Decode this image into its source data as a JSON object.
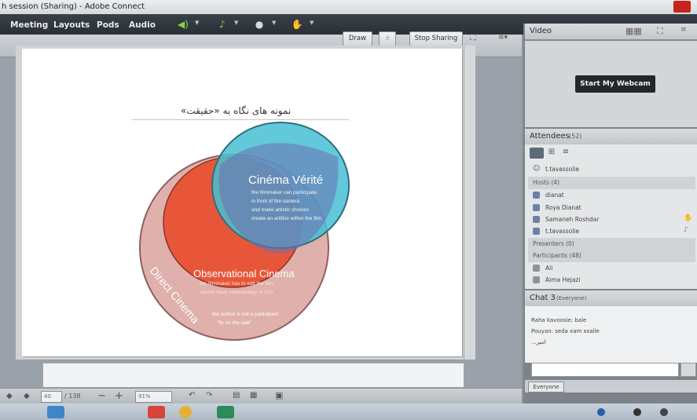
{
  "window": {
    "title": "h session (Sharing) - Adobe Connect"
  },
  "menubar": {
    "items": [
      "Meeting",
      "Layouts",
      "Pods",
      "Audio"
    ],
    "icons": [
      "speaker-icon",
      "microphone-icon",
      "person-icon",
      "raise-hand-icon"
    ]
  },
  "share_toolbar": {
    "draw_label": "Draw",
    "stop_label": "Stop Sharing"
  },
  "slide": {
    "title": "نمونه های نگاه به «حقیقت»",
    "circles": [
      {
        "heading": "Cinéma Vérité",
        "lines": [
          "the filmmaker can participate",
          "in front of the camera",
          "and make artistic choices",
          "create an artifice within the film"
        ]
      },
      {
        "heading": "Observational Cinema",
        "lines": [
          "the filmmaker has to edit the film,",
          "cannot have commentary or V.O."
        ]
      },
      {
        "heading": "Direct Cinema",
        "lines": [
          "the author is not a participant",
          "\"fly on the wall\""
        ]
      }
    ],
    "colors": {
      "verite": "#45bfd3",
      "observational": "#e8563a",
      "direct": "#d9a29e"
    }
  },
  "bottom_toolbar": {
    "page": "40",
    "total": "/ 138",
    "zoom": "91%"
  },
  "video_pod": {
    "title": "Video",
    "webcam_button": "Start My Webcam"
  },
  "attendees_pod": {
    "title": "Attendees",
    "count": "(52)",
    "me": "t.tavassolie",
    "hosts_label": "Hosts (4)",
    "hosts": [
      "dianat",
      "Roya Dianat",
      "Samaneh Roshdar",
      "t.tavassolie"
    ],
    "presenters_label": "Presenters (0)",
    "participants_label": "Participants (48)",
    "participants": [
      "Ali",
      "Aima Hejazi"
    ]
  },
  "chat_pod": {
    "title": "Chat 3",
    "scope": "(Everyone)",
    "messages": [
      "Raha kavoosie: bale",
      "Pouyan: seda xam xsaile",
      "امیر..."
    ],
    "recipient": "Everyone"
  }
}
